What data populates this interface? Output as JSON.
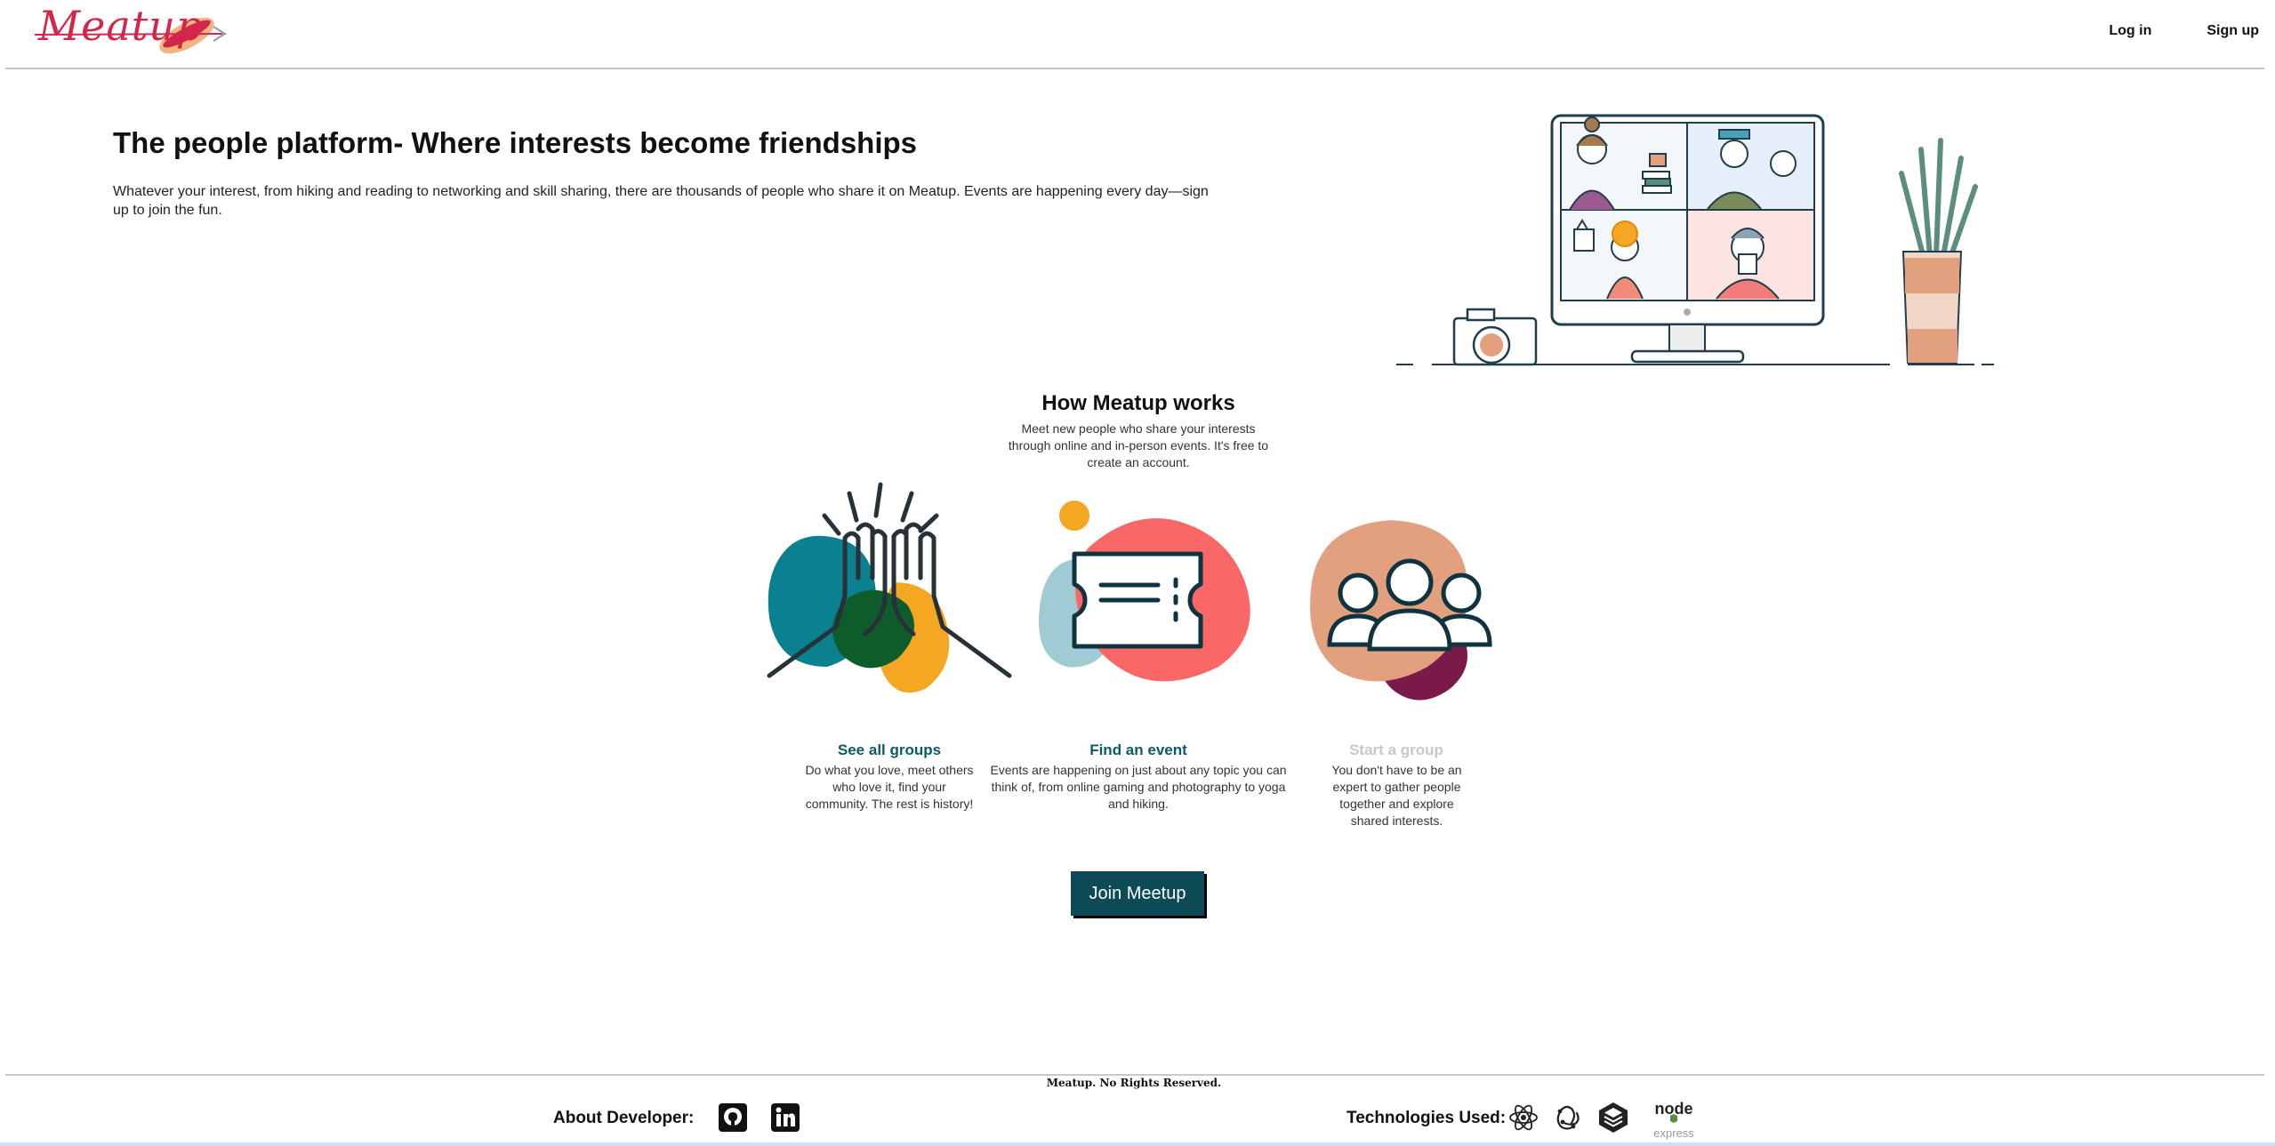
{
  "header": {
    "logo_text": "Meatup",
    "nav": {
      "login": "Log in",
      "signup": "Sign up"
    }
  },
  "hero": {
    "title": "The people platform- Where interests become friendships",
    "text": "Whatever your interest, from hiking and reading to networking and skill sharing, there are thousands of people who share it on Meatup. Events are happening every day—sign up to join the fun."
  },
  "how": {
    "title": "How Meatup works",
    "subtitle": "Meet new people who share your interests through online and in-person events. It's free to create an account."
  },
  "cards": [
    {
      "title": "See all groups",
      "text": "Do what you love, meet others who love it, find your community. The rest is history!",
      "title_color": "#0c5a66",
      "icon": "high-five-icon"
    },
    {
      "title": "Find an event",
      "text": "Events are happening on just about any topic you can think of, from online gaming and photography to yoga and hiking.",
      "title_color": "#0c5a66",
      "icon": "ticket-icon"
    },
    {
      "title": "Start a group",
      "text": "You don't have to be an expert to gather people together and explore shared interests.",
      "title_color": "#c8c8c8",
      "icon": "people-group-icon"
    }
  ],
  "join_button": "Join Meetup",
  "footer": {
    "copyright": "Meatup. No Rights Reserved.",
    "about_label": "About Developer:",
    "tech_label": "Technologies Used:",
    "about_icons": [
      "github-icon",
      "linkedin-icon"
    ],
    "tech_icons": [
      "react-icon",
      "redux-icon",
      "sequelize-icon",
      "node-express-icon"
    ],
    "node_text": "node",
    "express_text": "express"
  },
  "colors": {
    "brand": "#d2274a",
    "teal_dark": "#0c4b55",
    "teal": "#00808f",
    "orange": "#f5a623",
    "coral": "#f25f5c",
    "peach": "#e3a07e",
    "plum": "#7a1a48"
  }
}
